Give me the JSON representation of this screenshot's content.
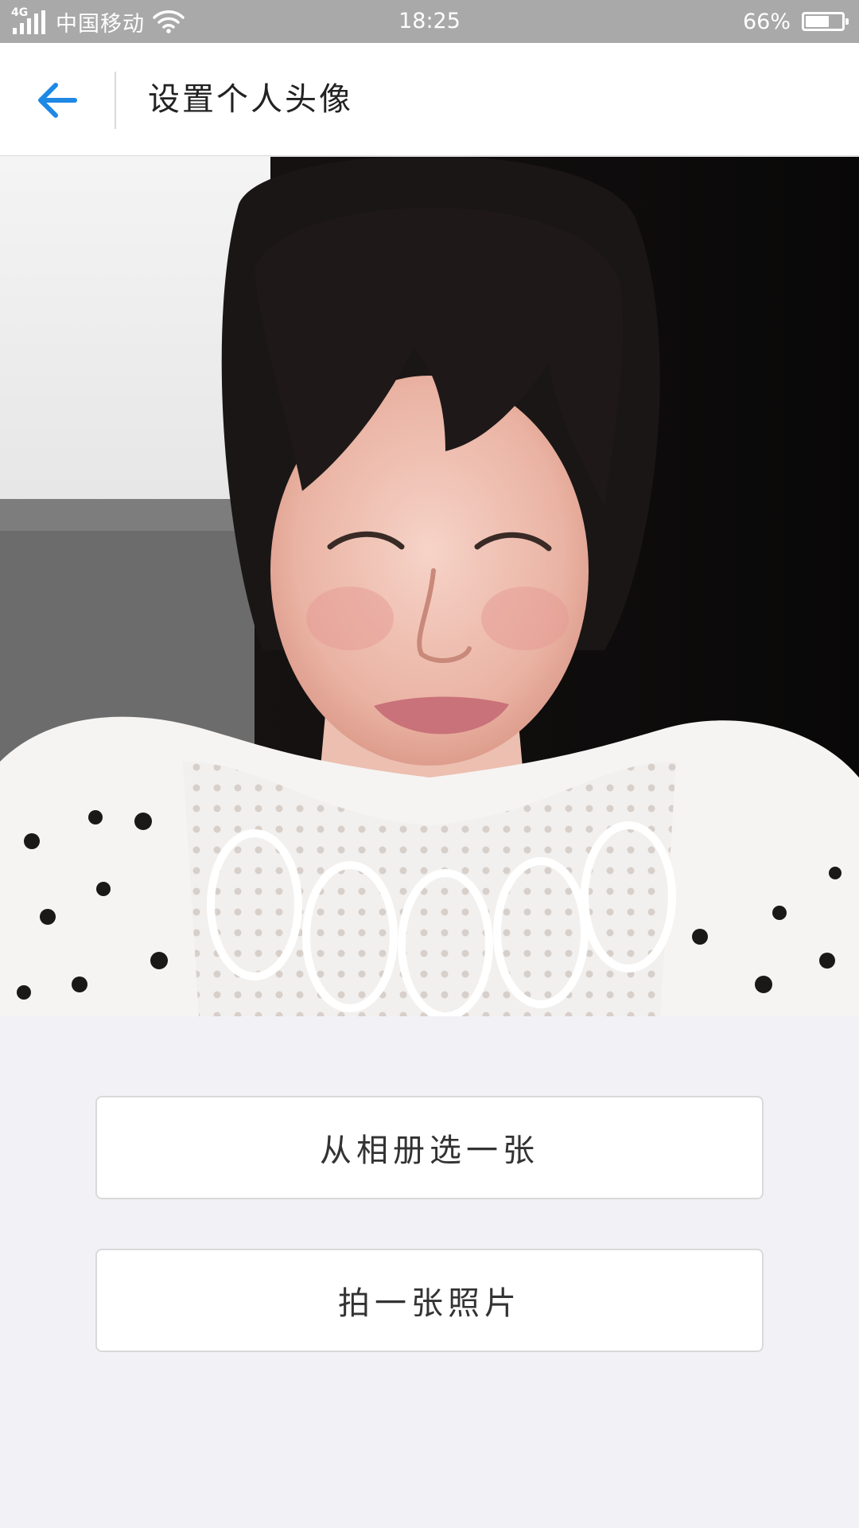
{
  "status_bar": {
    "network": "4G",
    "carrier": "中国移动",
    "time": "18:25",
    "battery_text": "66%",
    "battery_level": 0.66
  },
  "nav": {
    "title": "设置个人头像",
    "back_icon": "arrow-left-icon",
    "accent_color": "#1e88e5"
  },
  "photo": {
    "name": "avatar-photo"
  },
  "actions": {
    "choose_from_album": "从相册选一张",
    "take_photo": "拍一张照片"
  }
}
